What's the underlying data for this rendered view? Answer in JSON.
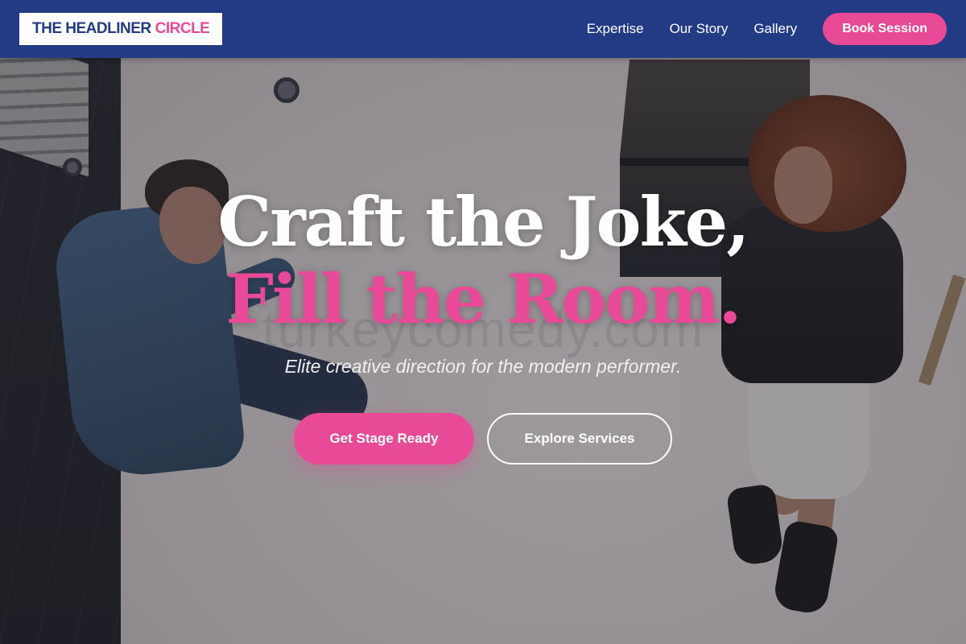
{
  "header": {
    "logo_main": "THE HEADLINER",
    "logo_accent": "CIRCLE",
    "nav": [
      "Expertise",
      "Our Story",
      "Gallery"
    ],
    "cta": "Book Session"
  },
  "hero": {
    "headline_line1": "Craft the Joke,",
    "headline_line2": "Fill the Room.",
    "subtitle": "Elite creative direction for the modern performer.",
    "primary_cta": "Get Stage Ready",
    "secondary_cta": "Explore Services",
    "watermark": "turkeycomedy.com"
  },
  "colors": {
    "header_bg": "#233a85",
    "accent_pink": "#e84a98",
    "white": "#ffffff"
  }
}
